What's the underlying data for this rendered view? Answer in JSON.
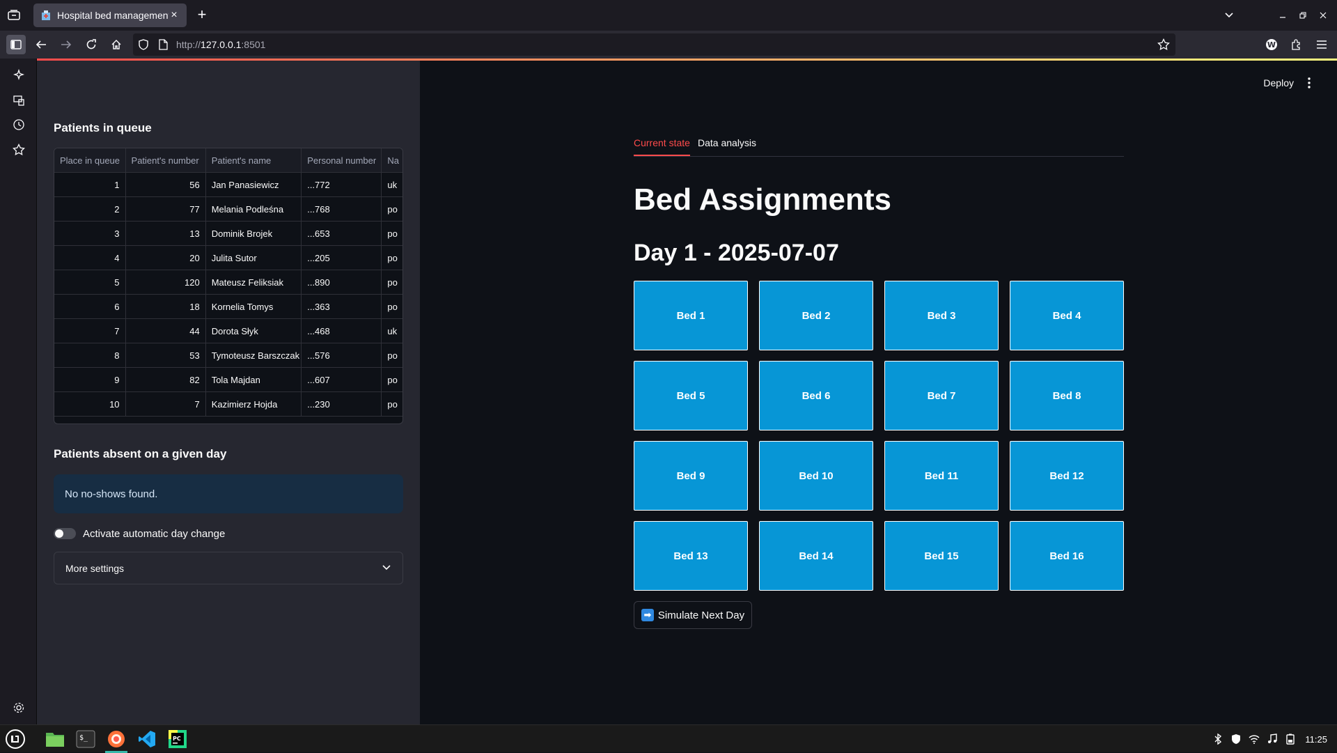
{
  "browser": {
    "tab_title": "Hospital bed management",
    "url_prefix": "http://",
    "url_host": "127.0.0.1",
    "url_port": ":8501"
  },
  "sidebar": {
    "queue_title": "Patients in queue",
    "queue_columns": [
      "Place in queue",
      "Patient's number",
      "Patient's name",
      "Personal number",
      "Na"
    ],
    "queue_rows": [
      [
        "1",
        "56",
        "Jan Panasiewicz",
        "...772",
        "uk"
      ],
      [
        "2",
        "77",
        "Melania Podleśna",
        "...768",
        "po"
      ],
      [
        "3",
        "13",
        "Dominik Brojek",
        "...653",
        "po"
      ],
      [
        "4",
        "20",
        "Julita Sutor",
        "...205",
        "po"
      ],
      [
        "5",
        "120",
        "Mateusz Feliksiak",
        "...890",
        "po"
      ],
      [
        "6",
        "18",
        "Kornelia Tomys",
        "...363",
        "po"
      ],
      [
        "7",
        "44",
        "Dorota Słyk",
        "...468",
        "uk"
      ],
      [
        "8",
        "53",
        "Tymoteusz Barszczak",
        "...576",
        "po"
      ],
      [
        "9",
        "82",
        "Tola Majdan",
        "...607",
        "po"
      ],
      [
        "10",
        "7",
        "Kazimierz Hojda",
        "...230",
        "po"
      ]
    ],
    "absent_title": "Patients absent on a given day",
    "absent_info": "No no-shows found.",
    "toggle_label": "Activate automatic day change",
    "toggle_on": false,
    "expander_label": "More settings"
  },
  "main": {
    "deploy_label": "Deploy",
    "tabs": [
      {
        "label": "Current state",
        "active": true
      },
      {
        "label": "Data analysis",
        "active": false
      }
    ],
    "title": "Bed Assignments",
    "day_heading": "Day 1 - 2025-07-07",
    "beds": [
      "Bed 1",
      "Bed 2",
      "Bed 3",
      "Bed 4",
      "Bed 5",
      "Bed 6",
      "Bed 7",
      "Bed 8",
      "Bed 9",
      "Bed 10",
      "Bed 11",
      "Bed 12",
      "Bed 13",
      "Bed 14",
      "Bed 15",
      "Bed 16"
    ],
    "bed_color": "#0796d6",
    "simulate_label": "Simulate Next Day"
  },
  "taskbar": {
    "clock": "11:25"
  },
  "colors": {
    "accent": "#ff4b4b",
    "sidebar_bg": "#262730",
    "main_bg": "#0e1117",
    "info_bg": "#172d43"
  }
}
